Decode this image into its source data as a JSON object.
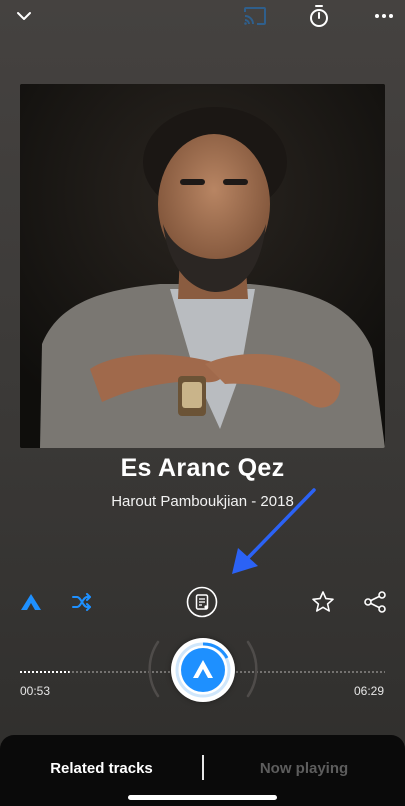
{
  "track": {
    "title": "Es Aranc Qez",
    "subtitle": "Harout Pamboukjian - 2018"
  },
  "player": {
    "elapsed": "00:53",
    "duration": "06:29",
    "progress_fraction": 0.136
  },
  "tabs": {
    "related": "Related tracks",
    "now_playing": "Now playing",
    "active": "related"
  },
  "icons": {
    "collapse": "chevron-down-icon",
    "cast": "cast-icon",
    "timer": "timer-icon",
    "more": "more-icon",
    "autoplay": "autoplay-icon",
    "shuffle": "shuffle-icon",
    "lyrics": "lyrics-icon",
    "favorite": "star-icon",
    "share": "share-icon",
    "play": "play-icon"
  },
  "colors": {
    "accent": "#1e90ff",
    "cast_inactive": "#2f5f8c",
    "annotation": "#2b62f5",
    "tab_inactive": "#5d5d5d"
  }
}
